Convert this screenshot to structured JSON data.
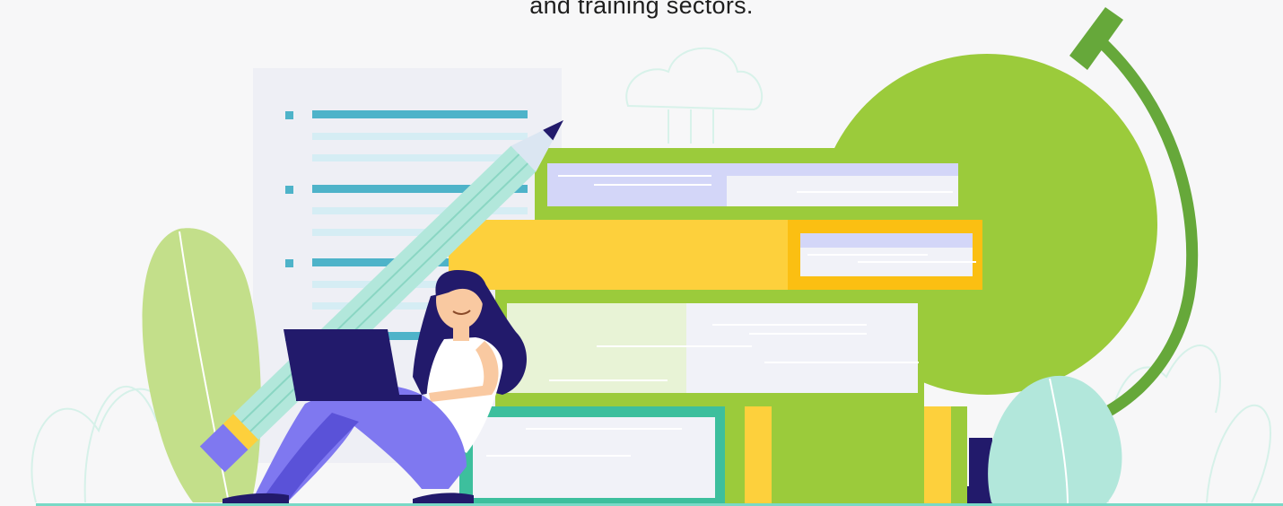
{
  "caption": {
    "text": "and training sectors."
  },
  "illustration": {
    "subjects": [
      "woman-with-laptop",
      "pencil",
      "book-stack",
      "globe",
      "document",
      "plants",
      "cloud"
    ],
    "colors": {
      "background": "#f7f7f8",
      "green": "#9bcb3b",
      "dark_green": "#66a83a",
      "yellow": "#fdd03c",
      "orange_yellow": "#fbbf12",
      "teal": "#3dbf9d",
      "mint": "#b2e7db",
      "navy": "#221a6b",
      "purple": "#7f78f0",
      "lavender": "#d3d6f8",
      "ground": "#79d9c6"
    }
  }
}
